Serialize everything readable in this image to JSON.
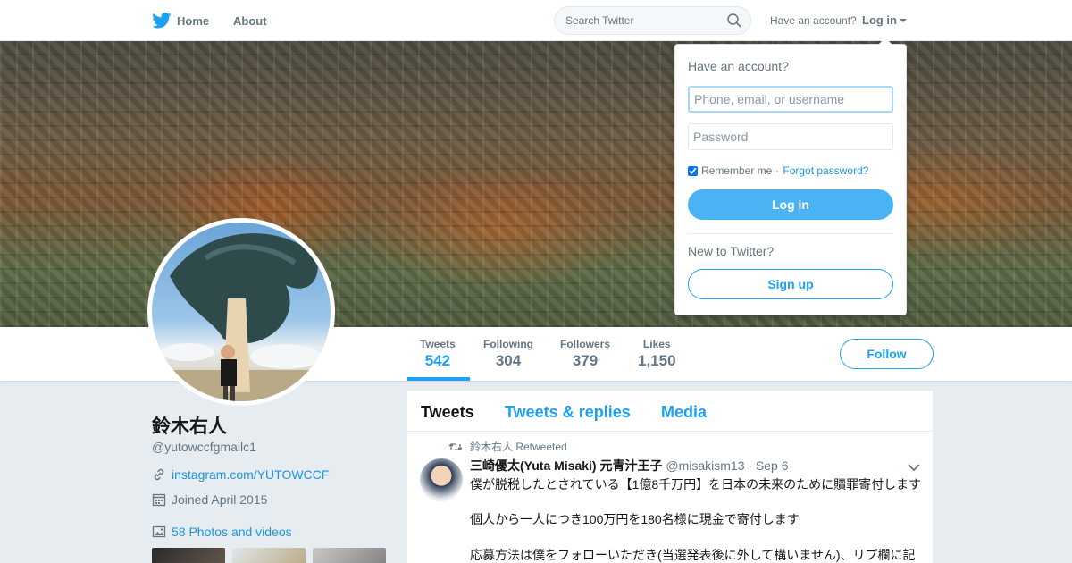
{
  "topbar": {
    "home_label": "Home",
    "about_label": "About",
    "search_placeholder": "Search Twitter",
    "have_account": "Have an account?",
    "login_label": "Log in"
  },
  "profile": {
    "name": "鈴木右人",
    "handle": "@yutowccfgmailc1",
    "website": "instagram.com/YUTOWCCF",
    "joined": "Joined April 2015",
    "photos_label": "58 Photos and videos"
  },
  "stats": [
    {
      "label": "Tweets",
      "value": "542"
    },
    {
      "label": "Following",
      "value": "304"
    },
    {
      "label": "Followers",
      "value": "379"
    },
    {
      "label": "Likes",
      "value": "1,150"
    }
  ],
  "follow_label": "Follow",
  "timeline": {
    "tabs": [
      "Tweets",
      "Tweets & replies",
      "Media"
    ],
    "tweet": {
      "retweet_context": "鈴木右人 Retweeted",
      "fullname": "三崎優太(Yuta Misaki) 元青汁王子",
      "handle": "@misakism13",
      "date": "· Sep 6",
      "lines": [
        "僕が脱税したとされている【1億8千万円】を日本の未来のために贖罪寄付します",
        "個人から一人につき100万円を180名様に現金で寄付します",
        "応募方法は僕をフォローいただき(当選発表後に外して構いません)、リプ欄に記"
      ]
    }
  },
  "login_dropdown": {
    "title": "Have an account?",
    "username_placeholder": "Phone, email, or username",
    "password_placeholder": "Password",
    "remember_label": "Remember me",
    "separator": "·",
    "forgot_label": "Forgot password?",
    "login_button": "Log in",
    "new_label": "New to Twitter?",
    "signup_button": "Sign up"
  },
  "colors": {
    "brand_blue": "#1da1f2",
    "login_blue": "#4ab3f4",
    "link_blue": "#1b95e0",
    "page_bg": "#e6ecf0",
    "muted_text": "#657786"
  },
  "icons": [
    "twitter-bird-icon",
    "search-icon",
    "link-icon",
    "calendar-icon",
    "photo-icon",
    "retweet-icon",
    "chevron-down-icon"
  ]
}
